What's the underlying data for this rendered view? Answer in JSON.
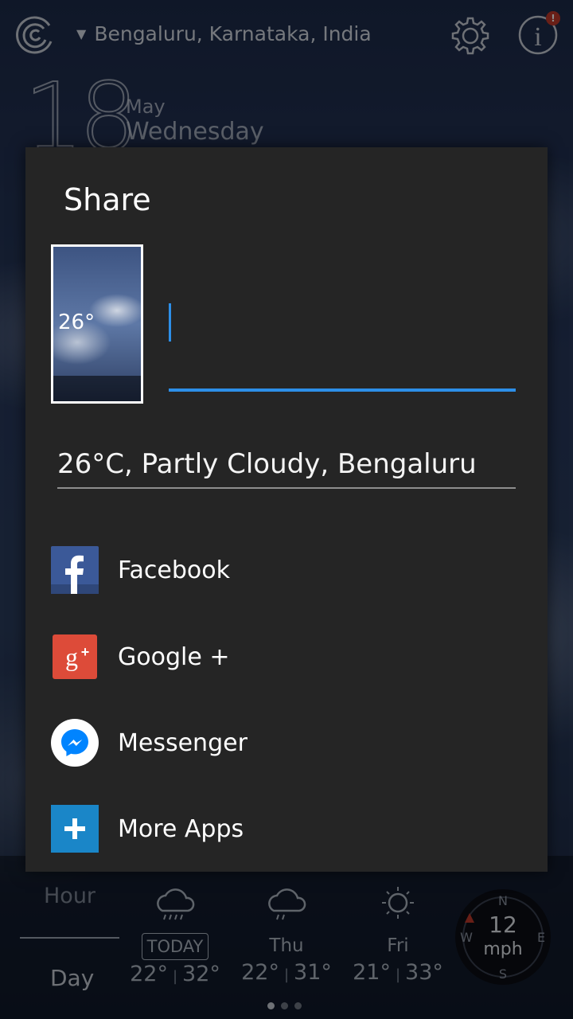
{
  "location": "Bengaluru, Karnataka, India",
  "date": {
    "day": "18",
    "month": "May",
    "weekday": "Wednesday"
  },
  "share": {
    "title": "Share",
    "preview_temp": "26°",
    "caption": "26°C, Partly Cloudy, Bengaluru",
    "options": [
      {
        "label": "Facebook",
        "icon": "facebook-icon",
        "color": "#3b5998"
      },
      {
        "label": "Google +",
        "icon": "google-plus-icon",
        "color": "#dd4b39"
      },
      {
        "label": "Messenger",
        "icon": "messenger-icon",
        "color": "#0084ff"
      },
      {
        "label": "More Apps",
        "icon": "plus-icon",
        "color": "#1a86c8"
      }
    ]
  },
  "tabs": {
    "hour": "Hour",
    "day": "Day"
  },
  "forecast": [
    {
      "day": "TODAY",
      "low": "22°",
      "high": "32°",
      "icon": "rain-cloud-icon"
    },
    {
      "day": "Thu",
      "low": "22°",
      "high": "31°",
      "icon": "rain-cloud-icon"
    },
    {
      "day": "Fri",
      "low": "21°",
      "high": "33°",
      "icon": "sun-icon"
    }
  ],
  "wind": {
    "value": "12",
    "unit": "mph",
    "compass": [
      "N",
      "E",
      "S",
      "W"
    ]
  }
}
